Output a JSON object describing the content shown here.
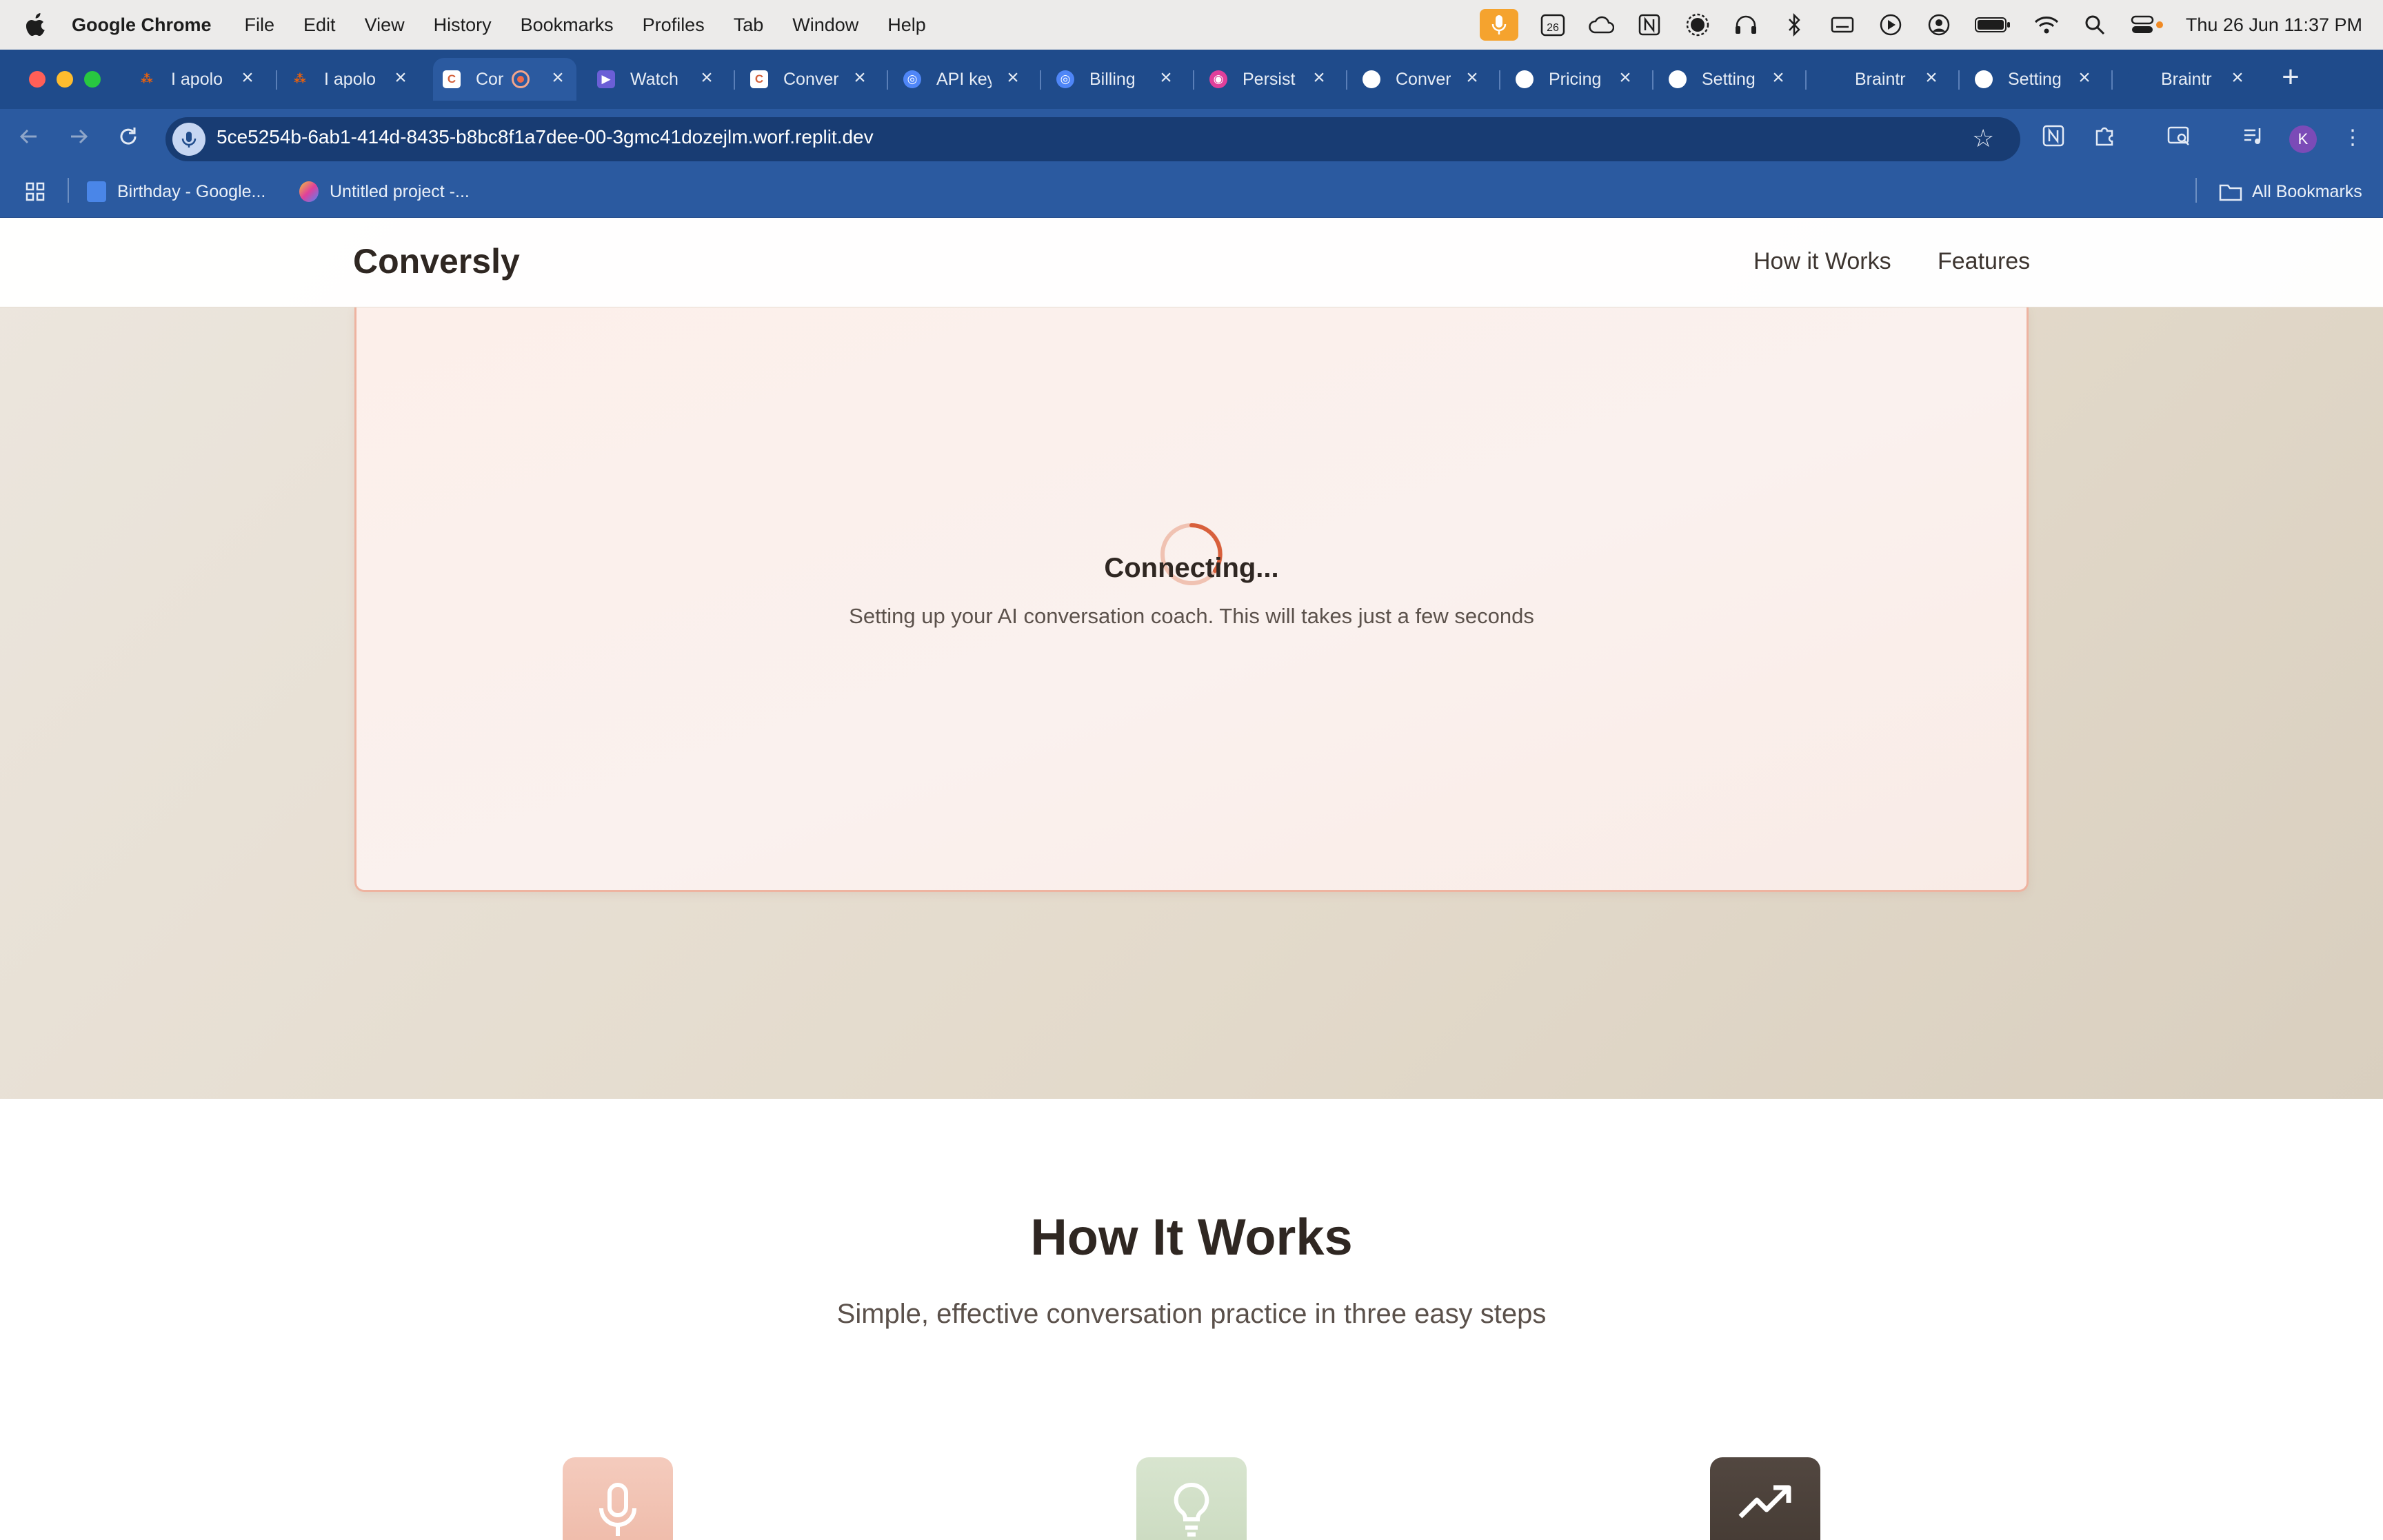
{
  "menubar": {
    "app_name": "Google Chrome",
    "items": [
      "File",
      "Edit",
      "View",
      "History",
      "Bookmarks",
      "Profiles",
      "Tab",
      "Window",
      "Help"
    ],
    "calendar_badge": "26",
    "clock": "Thu 26 Jun  11:37 PM"
  },
  "browser": {
    "tabs": [
      {
        "title": "I apolo",
        "active": false
      },
      {
        "title": "I apolo",
        "active": false
      },
      {
        "title": "Cor",
        "active": true,
        "favicon_letter": "C"
      },
      {
        "title": "Watch",
        "active": false
      },
      {
        "title": "Conver",
        "active": false,
        "favicon_letter": "C"
      },
      {
        "title": "API key",
        "active": false
      },
      {
        "title": "Billing",
        "active": false
      },
      {
        "title": "Persist",
        "active": false
      },
      {
        "title": "Conver",
        "active": false
      },
      {
        "title": "Pricing",
        "active": false
      },
      {
        "title": "Setting",
        "active": false
      },
      {
        "title": "Braintr",
        "active": false
      },
      {
        "title": "Setting",
        "active": false
      },
      {
        "title": "Braintr",
        "active": false
      }
    ],
    "url": "5ce5254b-6ab1-414d-8435-b8bc8f1a7dee-00-3gmc41dozejlm.worf.replit.dev",
    "profile_initial": "K",
    "bookmarks": [
      "Birthday - Google...",
      "Untitled project -..."
    ],
    "all_bookmarks": "All Bookmarks"
  },
  "site": {
    "brand": "Conversly",
    "nav_links": [
      "How it Works",
      "Features"
    ],
    "session": {
      "status_title": "Connecting...",
      "status_subtitle": "Setting up your AI conversation coach. This will takes just a few seconds"
    },
    "how_it_works": {
      "title": "How It Works",
      "subtitle": "Simple, effective conversation practice in three easy steps",
      "steps": [
        {
          "icon": "microphone-icon",
          "color": "#f2c4b6"
        },
        {
          "icon": "lightbulb-icon",
          "color": "#d3e0c9"
        },
        {
          "icon": "trending-up-icon",
          "color": "#4a3f38"
        }
      ]
    }
  }
}
